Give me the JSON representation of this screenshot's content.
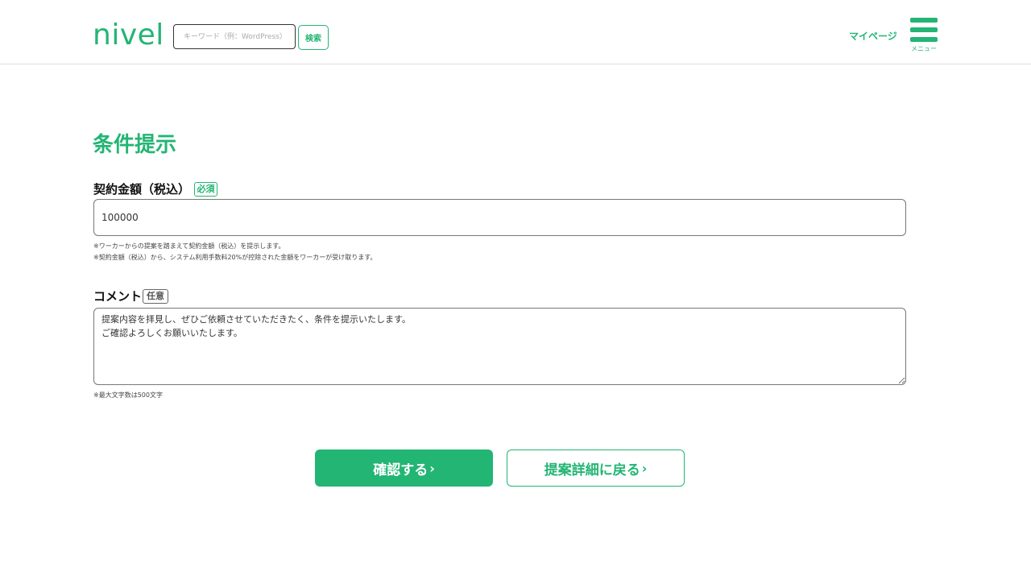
{
  "header": {
    "logo_text": "nivel",
    "search_placeholder": "キーワード（例：WordPress）",
    "search_button": "検索",
    "mypage_label": "マイページ",
    "menu_label": "メニュー"
  },
  "main": {
    "page_title": "条件提示",
    "amount": {
      "label": "契約金額（税込）",
      "badge": "必須",
      "value": "100000",
      "notes": [
        "※ワーカーからの提案を踏まえて契約金額（税込）を提示します。",
        "※契約金額（税込）から、システム利用手数料20%が控除された金額をワーカーが受け取ります。"
      ]
    },
    "comment": {
      "label": "コメント",
      "badge": "任意",
      "value": "提案内容を拝見し、ぜひご依頼させていただきたく、条件を提示いたします。\nご確認よろしくお願いいたします。",
      "note": "※最大文字数は500文字"
    },
    "buttons": {
      "confirm": "確認する",
      "back": "提案詳細に戻る",
      "chevron": "›"
    }
  },
  "colors": {
    "brand": "#23b574"
  }
}
